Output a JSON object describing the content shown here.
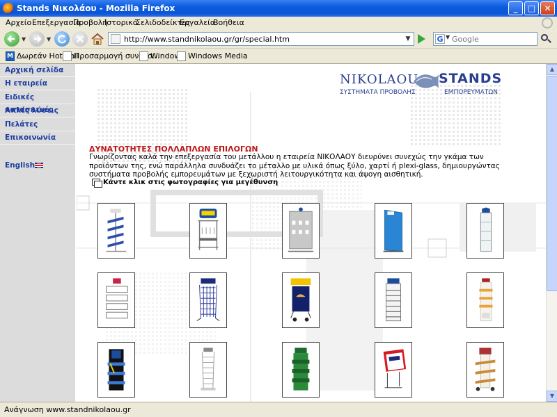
{
  "window": {
    "title": "Stands Νικολάου - Mozilla Firefox"
  },
  "menubar": {
    "items": [
      "Αρχείο",
      "Επεξεργασία",
      "Προβολή",
      "Ιστορικό",
      "Σελιδοδείκτες",
      "Εργαλεία",
      "Βοήθεια"
    ]
  },
  "navbar": {
    "url": "http://www.standnikolaou.gr/gr/special.htm",
    "search_placeholder": "Google",
    "search_engine_letter": "G"
  },
  "bookmarks": {
    "items": [
      "Δωρεάν Hotmail",
      "Προσαρμογή συνδέσ...",
      "Windows",
      "Windows Media"
    ]
  },
  "sitenav": {
    "items": [
      "Αρχική σελίδα",
      "Η εταιρεία",
      "Ειδικές κατασκευές",
      "Απλές λύσεις",
      "Πελάτες",
      "Επικοινωνία"
    ],
    "english": "English"
  },
  "logo": {
    "brand_left": "NIKOLAOU",
    "brand_right": "STANDS",
    "sub_left": "ΣΥΣΤΗΜΑΤΑ ΠΡΟΒΟΛΗΣ",
    "sub_right": "ΕΜΠΟΡΕΥΜΑΤΩΝ"
  },
  "main": {
    "heading": "ΔΥΝΑΤΟΤΗΤΕΣ ΠΟΛΛΑΠΛΩΝ ΕΠΙΛΟΓΩΝ",
    "paragraph": "Γνωρίζοντας καλά την επεξεργασία του μετάλλου η εταιρεία ΝΙΚΟΛΑΟΥ διευρύνει συνεχώς την γκάμα των προϊόντων της, ενώ παράλληλα συνδυάζει το μέταλλο με υλικά όπως ξύλο, χαρτί ή plexi-glass, δημιουργώντας συστήματα προβολής εμπορευμάτων με ξεχωριστή λειτουργικότητα και άψογη αισθητική.",
    "hint": "Κάντε κλικ στις φωτογραφίες για μεγέθυνση"
  },
  "gallery": {
    "photos": [
      {
        "name": "stand-photo-1",
        "style": "blue-tiered-rack"
      },
      {
        "name": "stand-photo-2",
        "style": "scotch-hook-stand"
      },
      {
        "name": "stand-photo-3",
        "style": "grey-pegboard"
      },
      {
        "name": "stand-photo-4",
        "style": "blue-pegboard"
      },
      {
        "name": "stand-photo-5",
        "style": "glass-cabinet"
      },
      {
        "name": "stand-photo-6",
        "style": "wire-basket-rack"
      },
      {
        "name": "stand-photo-7",
        "style": "blue-wire-rack"
      },
      {
        "name": "stand-photo-8",
        "style": "camel-stand"
      },
      {
        "name": "stand-photo-9",
        "style": "multi-shelf-rack"
      },
      {
        "name": "stand-photo-10",
        "style": "wood-shelf-stand"
      },
      {
        "name": "stand-photo-11",
        "style": "black-blue-stand"
      },
      {
        "name": "stand-photo-12",
        "style": "silver-wire-stand"
      },
      {
        "name": "stand-photo-13",
        "style": "green-shelf-stand"
      },
      {
        "name": "stand-photo-14",
        "style": "duro-stick-sign"
      },
      {
        "name": "stand-photo-15",
        "style": "wood-shelf-cart"
      }
    ]
  },
  "status": {
    "text": "Ανάγνωση www.standnikolaou.gr"
  },
  "colors": {
    "nav_link": "#2040a0",
    "heading": "#c01818",
    "logo_blue": "#2b3f8f",
    "sidebar_bg": "#dcdcdc"
  }
}
